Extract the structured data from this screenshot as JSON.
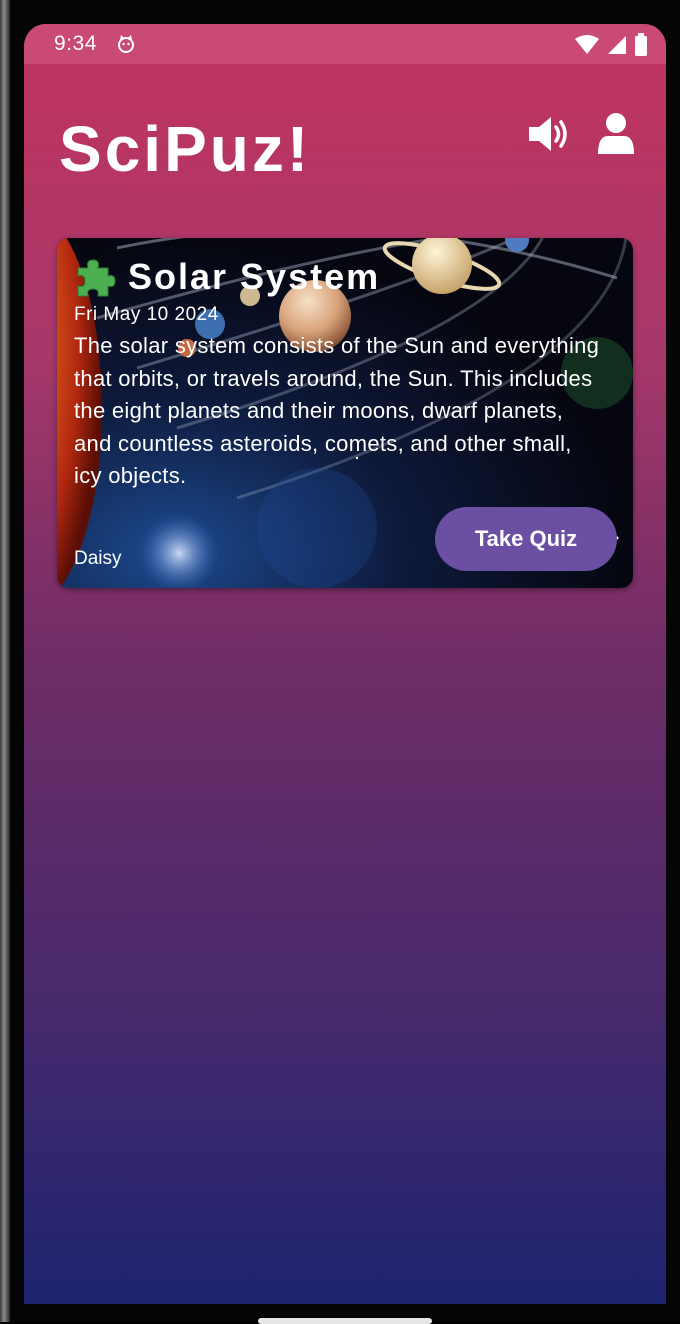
{
  "status_bar": {
    "time": "9:34",
    "app_icon": "cat-face-icon",
    "wifi_icon": "wifi-icon",
    "signal_icon": "signal-icon",
    "battery_icon": "battery-icon"
  },
  "header": {
    "title": "SciPuz!",
    "sound_icon": "speaker-icon",
    "profile_icon": "user-icon"
  },
  "puzzles": [
    {
      "icon": "puzzle-piece-icon",
      "title": "Solar System",
      "date": "Fri May 10 2024",
      "description": "The solar system consists of the Sun and everything that orbits, or travels around, the Sun. This includes the eight planets and their moons, dwarf planets, and countless asteroids, comets, and other small, icy objects.",
      "author": "Daisy",
      "action_label": "Take Quiz"
    }
  ],
  "colors": {
    "status_bar": "#c94a74",
    "gradient_top": "#c2335f",
    "gradient_bottom": "#1e2470",
    "button": "#6a4fa3",
    "puzzle_icon": "#4caf50"
  }
}
